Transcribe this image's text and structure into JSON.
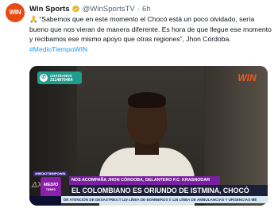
{
  "tweet": {
    "name": "Win Sports",
    "handle": "@WinSportsTV",
    "separator": "·",
    "time": "6h",
    "emoji": "🙏",
    "text": "“Sabemos que en este momento el Chocó está un poco olvidado, sería bueno que nos vieran de manera diferente. Es hora de que llegue ese momento y recibamos ese mismo apoyo que otras regiones”, Jhon Córdoba.",
    "hashtag": "#MedioTiempoWIN"
  },
  "avatar": {
    "logo_text": "WIN"
  },
  "video": {
    "chat_badge": {
      "line1": "CHATÉANOS",
      "line2": "3114876464"
    },
    "corner_logo": "WIN",
    "preset_tag": "#MEDIOTIEMPOWIN",
    "show_logo": {
      "line1": "MEDIO",
      "line2": "TIEMPO"
    },
    "lower_third_top": "NOS ACOMPAÑA JHON CÓRDOBA, DELANTERO F.C. KRASNODAR",
    "lower_third_main": "EL COLOMBIANO ES ORIUNDO DE ISTMINA, CHOCÓ",
    "ticker": "DE ATENCIÓN DE DESASTRES // 119 LÍNEA DE BOMBEROS // 125 LÍNEA DE AMBULANCIAS Y URGENCIAS MÉ"
  },
  "colors": {
    "brand_orange": "#e84a14",
    "hashtag_blue": "#1d9bf0",
    "verified_gold": "#e2b719",
    "lower_third_purple": "#7a1fa0",
    "lower_third_navy": "#1c1f3a"
  }
}
